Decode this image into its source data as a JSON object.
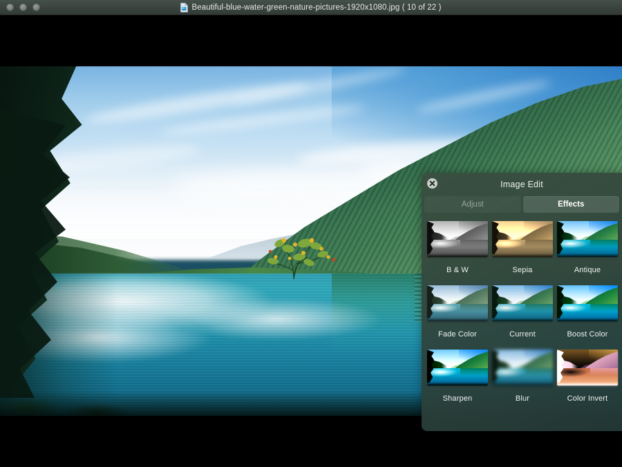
{
  "window": {
    "title": "Beautiful-blue-water-green-nature-pictures-1920x1080.jpg ( 10 of 22 )",
    "file_icon": "document-image-icon",
    "traffic_lights": [
      "close",
      "minimize",
      "zoom"
    ]
  },
  "panel": {
    "title": "Image Edit",
    "close_icon": "close-circle-icon",
    "tabs": [
      {
        "label": "Adjust",
        "active": false
      },
      {
        "label": "Effects",
        "active": true
      }
    ],
    "effects": [
      {
        "label": "B & W",
        "filter": "f-bw"
      },
      {
        "label": "Sepia",
        "filter": "f-sepia"
      },
      {
        "label": "Antique",
        "filter": "f-antique"
      },
      {
        "label": "Fade Color",
        "filter": "f-fade"
      },
      {
        "label": "Current",
        "filter": "f-current"
      },
      {
        "label": "Boost Color",
        "filter": "f-boost"
      },
      {
        "label": "Sharpen",
        "filter": "f-sharpen"
      },
      {
        "label": "Blur",
        "filter": "f-blur"
      },
      {
        "label": "Color Invert",
        "filter": "f-invert"
      }
    ]
  },
  "colors": {
    "titlebar": "#3b443f",
    "letterbox": "#000000",
    "panel_bg": "#3a4e40",
    "tab_active_text": "#ffffff",
    "tab_inactive_text": "#9ba79d",
    "water": "#1f93ad",
    "sky": "#9ccaea"
  }
}
